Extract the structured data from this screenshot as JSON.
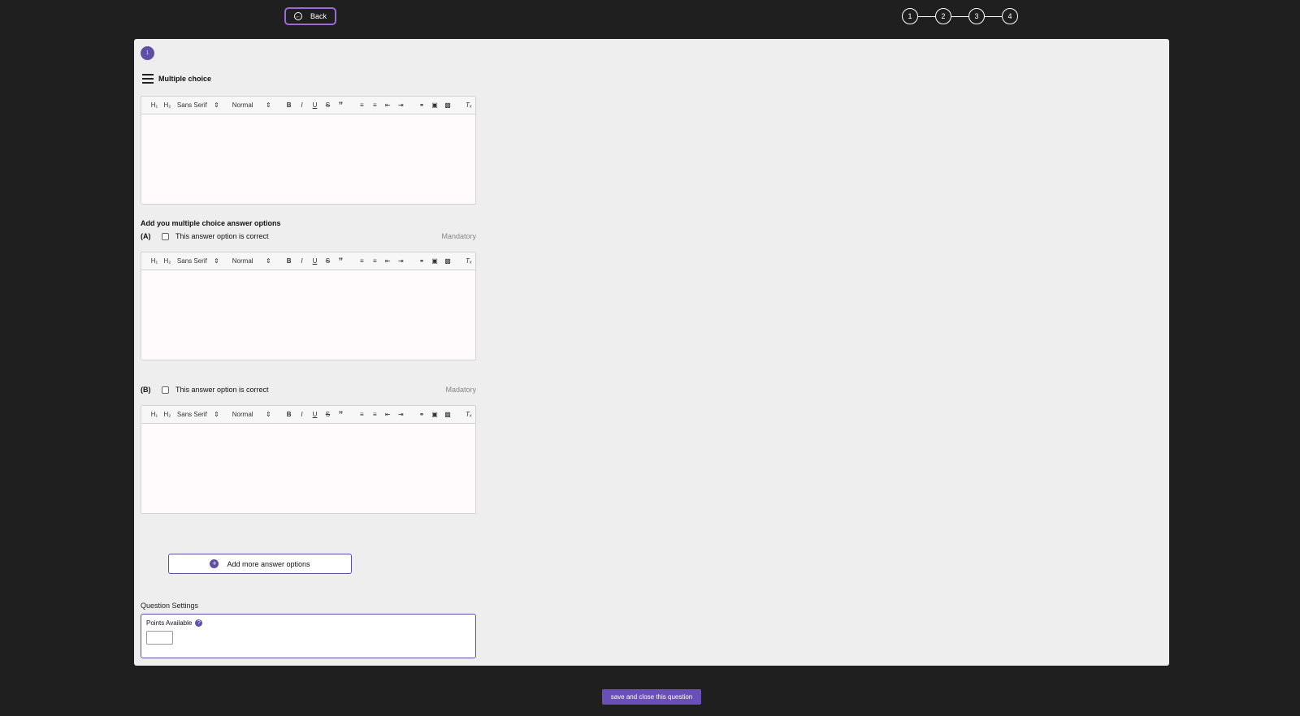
{
  "header": {
    "back_label": "Back",
    "steps": [
      "1",
      "2",
      "3",
      "4"
    ]
  },
  "question": {
    "number": "1",
    "type_label": "Multiple choice",
    "section_title": "Add you multiple choice answer options"
  },
  "toolbar": {
    "h1": "H₁",
    "h2": "H₂",
    "font": "Sans Serif",
    "size": "Normal",
    "bold": "B",
    "italic": "I",
    "underline": "U",
    "strike": "S",
    "quote": "”",
    "clear": "Tₓ"
  },
  "options": [
    {
      "letter": "(A)",
      "correct_label": "This answer option is correct",
      "status": "Mandatory"
    },
    {
      "letter": "(B)",
      "correct_label": "This answer option is correct",
      "status": "Madatory"
    }
  ],
  "add_more_label": "Add more answer options",
  "settings": {
    "title": "Question Settings",
    "points_label": "Points Available",
    "points_value": ""
  },
  "footer": {
    "save_label": "save and close this question"
  },
  "colors": {
    "accent": "#5e4ea6",
    "save_button": "#6b4fb8",
    "back_border": "#9b6ad6",
    "page_bg": "#1f1f1f",
    "panel_bg": "#eeeeee"
  }
}
